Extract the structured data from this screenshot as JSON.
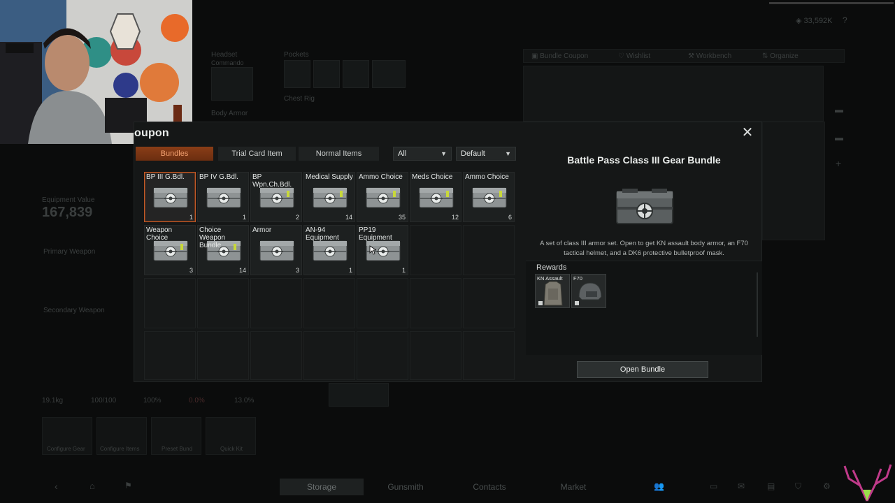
{
  "dialog": {
    "title": "oupon",
    "tabs": [
      {
        "label": "Bundles",
        "active": true
      },
      {
        "label": "Trial Card Item",
        "active": false
      },
      {
        "label": "Normal Items",
        "active": false
      }
    ],
    "filter_select": "All",
    "sort_select": "Default",
    "items": [
      {
        "name": "BP III G.Bdl.",
        "count": "1",
        "selected": true
      },
      {
        "name": "BP IV G.Bdl.",
        "count": "1"
      },
      {
        "name": "BP Wpn.Ch.Bdl.",
        "count": "2"
      },
      {
        "name": "Medical Supply",
        "count": "14"
      },
      {
        "name": "Ammo Choice",
        "count": "35"
      },
      {
        "name": "Meds Choice",
        "count": "12"
      },
      {
        "name": "Ammo Choice",
        "count": "6"
      },
      {
        "name": "Weapon Choice",
        "count": "3"
      },
      {
        "name": "Choice Weapon Bundle",
        "count": "14"
      },
      {
        "name": "Armor",
        "count": "3"
      },
      {
        "name": "AN-94 Equipment",
        "count": "1"
      },
      {
        "name": "PP19 Equipment",
        "count": "1"
      }
    ],
    "detail": {
      "title": "Battle Pass Class III Gear Bundle",
      "description": "A set of class III armor set. Open to get KN assault body armor, an F70 tactical helmet, and a DK6 protective bulletproof mask.",
      "rewards_label": "Rewards",
      "rewards": [
        {
          "name": "KN Assault"
        },
        {
          "name": "F70"
        }
      ],
      "open_button": "Open Bundle"
    }
  },
  "background": {
    "currency": "33,592K",
    "equipment_value_label": "Equipment Value",
    "equipment_value": "167,839",
    "headset_label": "Headset",
    "headset_value": "Commando",
    "pockets_label": "Pockets",
    "chest_rig_label": "Chest Rig",
    "body_armor_label": "Body Armor",
    "primary_weapon_label": "Primary Weapon",
    "secondary_weapon_label": "Secondary Weapon",
    "top_tabs": [
      "Bundle Coupon",
      "Wishlist",
      "Workbench",
      "Organize"
    ],
    "stats": [
      "19.1kg",
      "100/100",
      "100%",
      "0.0%",
      "13.0%"
    ],
    "quick_buttons": [
      "Configure Gear",
      "Configure Items",
      "Preset Bund",
      "Quick Kit"
    ],
    "bottom_tabs": [
      {
        "label": "Storage",
        "active": true
      },
      {
        "label": "Gunsmith"
      },
      {
        "label": "Contacts"
      },
      {
        "label": "Market"
      }
    ]
  },
  "colors": {
    "accent": "#c05a28",
    "panel": "#151717",
    "active_tab": "#7a3513"
  }
}
